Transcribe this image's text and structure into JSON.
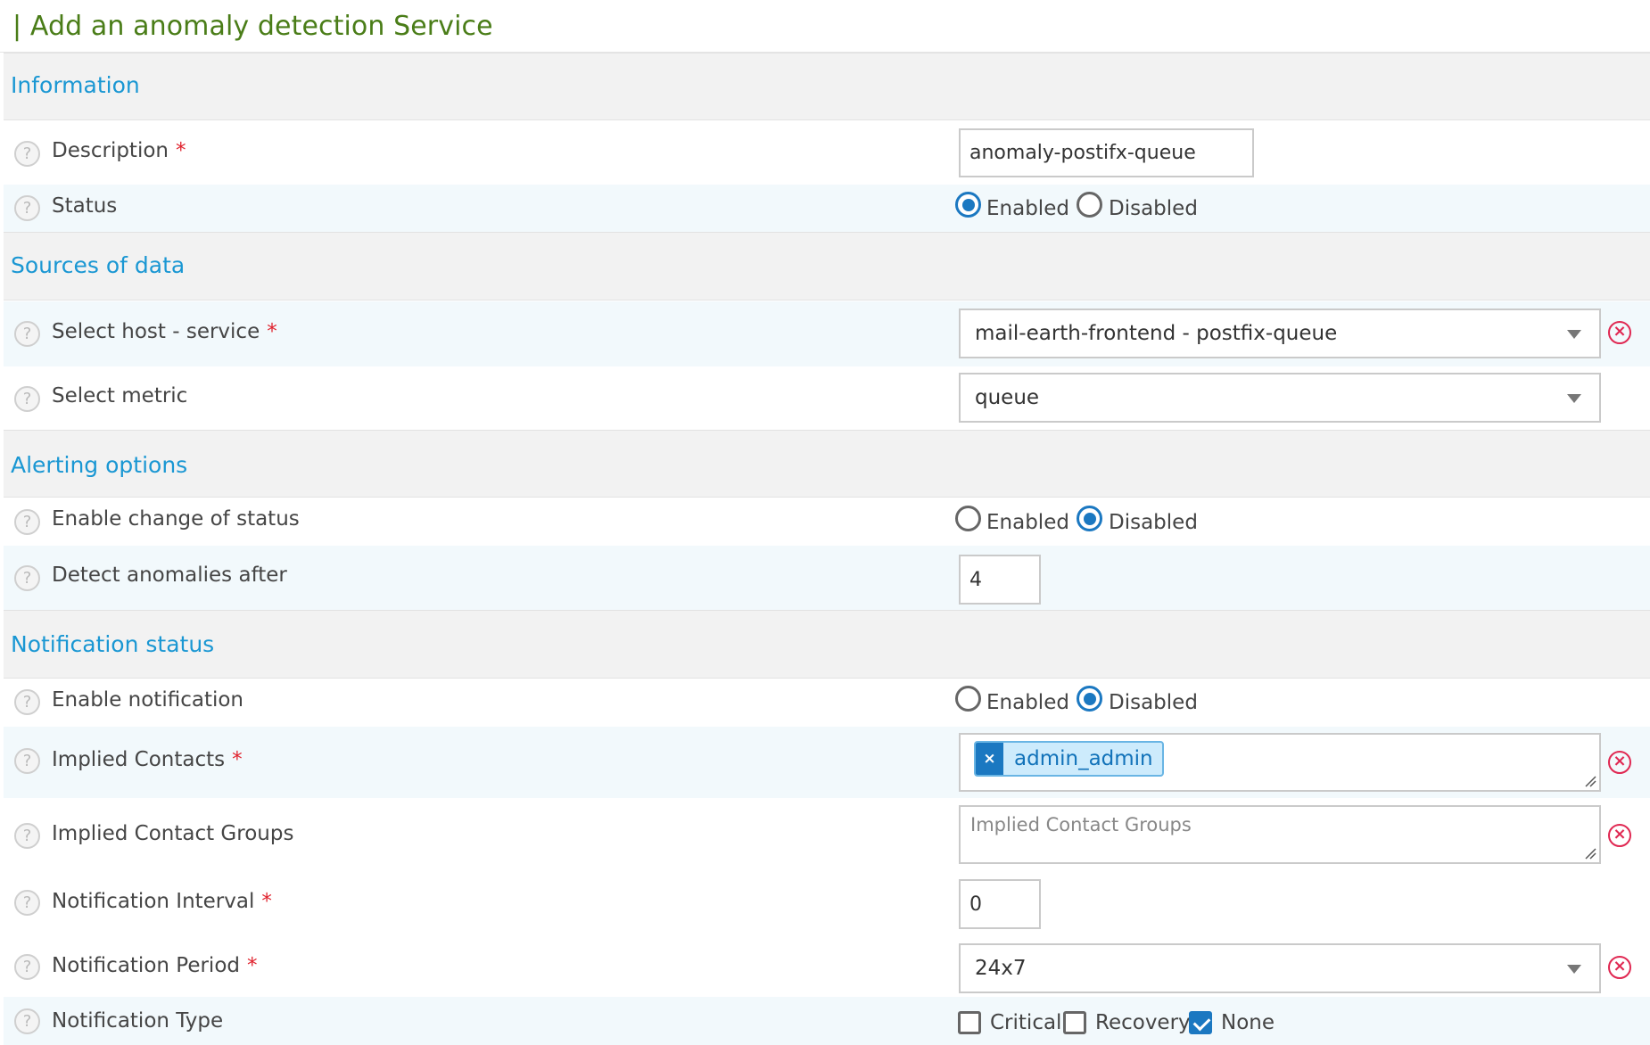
{
  "page": {
    "title": "| Add an anomaly detection Service"
  },
  "sections": {
    "information": "Information",
    "sources": "Sources of data",
    "alerting": "Alerting options",
    "notification": "Notification status"
  },
  "help_glyph": "?",
  "required_mark": "*",
  "fields": {
    "description": {
      "label": "Description",
      "value": "anomaly-postifx-queue",
      "required": true
    },
    "status": {
      "label": "Status",
      "options": [
        "Enabled",
        "Disabled"
      ],
      "selected": "Enabled"
    },
    "host_service": {
      "label": "Select host - service",
      "value": "mail-earth-frontend - postfix-queue",
      "required": true
    },
    "metric": {
      "label": "Select metric",
      "value": "queue"
    },
    "change_of_status": {
      "label": "Enable change of status",
      "options": [
        "Enabled",
        "Disabled"
      ],
      "selected": "Disabled"
    },
    "detect_after": {
      "label": "Detect anomalies after",
      "value": "4"
    },
    "enable_notification": {
      "label": "Enable notification",
      "options": [
        "Enabled",
        "Disabled"
      ],
      "selected": "Disabled"
    },
    "implied_contacts": {
      "label": "Implied Contacts",
      "required": true,
      "tags": [
        "admin_admin"
      ],
      "remove_glyph": "×"
    },
    "implied_contact_groups": {
      "label": "Implied Contact Groups",
      "placeholder": "Implied Contact Groups"
    },
    "notification_interval": {
      "label": "Notification Interval",
      "value": "0",
      "required": true
    },
    "notification_period": {
      "label": "Notification Period",
      "value": "24x7",
      "required": true
    },
    "notification_type": {
      "label": "Notification Type",
      "options": [
        "Critical",
        "Recovery",
        "None"
      ],
      "checked": [
        "None"
      ]
    }
  },
  "clear_glyph": "×",
  "colors": {
    "title": "#4a7d18",
    "section": "#1a97d3",
    "accent": "#1b78c1",
    "required": "#e0222d",
    "clear": "#e02852"
  }
}
